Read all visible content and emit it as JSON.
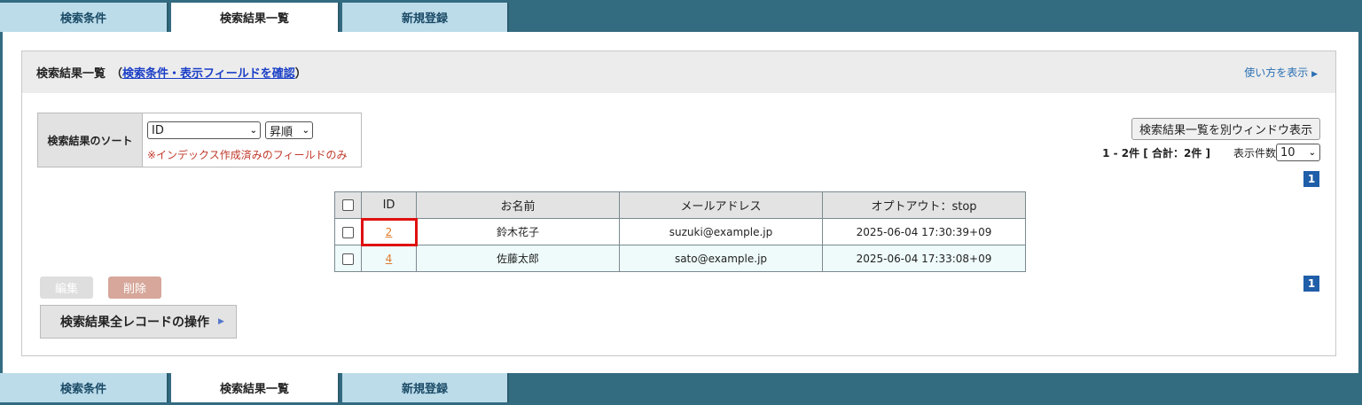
{
  "tabs": [
    "検索条件",
    "検索結果一覧",
    "新規登録"
  ],
  "header": {
    "title": "検索結果一覧",
    "link_open": "（",
    "link_text": "検索条件・表示フィールドを確認",
    "link_close": "）",
    "help": "使い方を表示"
  },
  "sort": {
    "label": "検索結果のソート",
    "field_value": "ID",
    "order_value": "昇順",
    "note": "※インデックス作成済みのフィールドのみ"
  },
  "toolbar": {
    "new_window_button": "検索結果一覧を別ウィンドウ表示",
    "count_text": "1 - 2件 [ 合計：2件 ]",
    "per_page_label": "表示件数",
    "per_page_value": "10"
  },
  "pagination": {
    "current_page": "1"
  },
  "table": {
    "headers": [
      "ID",
      "お名前",
      "メールアドレス",
      "オプトアウト：stop"
    ],
    "rows": [
      {
        "id": "2",
        "name": "鈴木花子",
        "email": "suzuki@example.jp",
        "optout": "2025-06-04 17:30:39+09"
      },
      {
        "id": "4",
        "name": "佐藤太郎",
        "email": "sato@example.jp",
        "optout": "2025-06-04 17:33:08+09"
      }
    ]
  },
  "actions": {
    "edit": "編集",
    "delete": "削除",
    "all_records": "検索結果全レコードの操作"
  },
  "icons": {
    "help_arrow": "triangle-right-icon",
    "dropdown": "chevron-down-icon"
  },
  "colors": {
    "frame": "#336b80",
    "tab": "#bcdcea",
    "link": "#1b3fc7",
    "id_link": "#e07b2f",
    "highlight": "#e01010",
    "page_badge": "#1f5ea8"
  }
}
